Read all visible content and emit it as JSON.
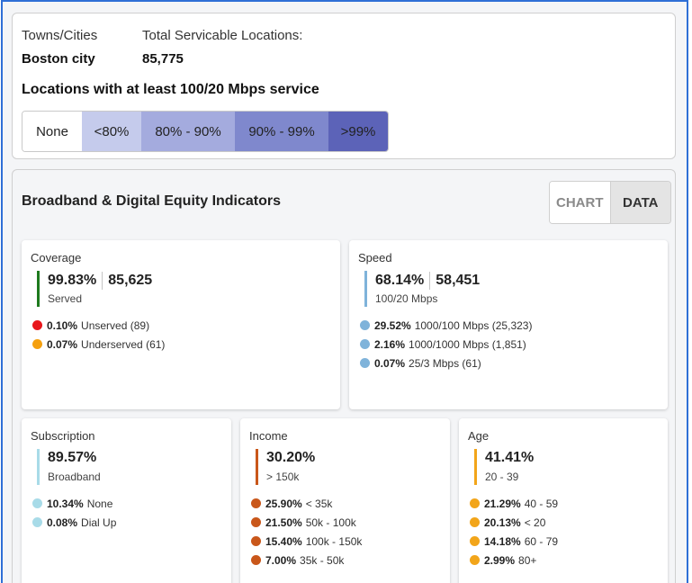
{
  "summary": {
    "towns_label": "Towns/Cities",
    "towns_value": "Boston city",
    "locations_label": "Total Servicable Locations:",
    "locations_value": "85,775",
    "legend_title": "Locations with at least 100/20 Mbps service",
    "legend": [
      {
        "label": "None",
        "color": "#ffffff"
      },
      {
        "label": "<80%",
        "color": "#c5cbec"
      },
      {
        "label": "80% - 90%",
        "color": "#a4abde"
      },
      {
        "label": "90% - 99%",
        "color": "#7f88cd"
      },
      {
        "label": ">99%",
        "color": "#5c63b8"
      }
    ]
  },
  "indicators": {
    "title": "Broadband & Digital Equity Indicators",
    "toggle": {
      "chart": "CHART",
      "data": "DATA",
      "active": "DATA"
    },
    "coverage": {
      "title": "Coverage",
      "pct": "99.83%",
      "count": "85,625",
      "sub": "Served",
      "bar_color": "#1e7a1e",
      "rows": [
        {
          "pct": "0.10%",
          "text": "Unserved (89)",
          "color": "#e8161b"
        },
        {
          "pct": "0.07%",
          "text": "Underserved (61)",
          "color": "#f5a00f"
        }
      ]
    },
    "speed": {
      "title": "Speed",
      "pct": "68.14%",
      "count": "58,451",
      "sub": "100/20 Mbps",
      "bar_color": "#7fb3da",
      "rows": [
        {
          "pct": "29.52%",
          "text": "1000/100 Mbps (25,323)",
          "color": "#7fb3da"
        },
        {
          "pct": "2.16%",
          "text": "1000/1000 Mbps (1,851)",
          "color": "#7fb3da"
        },
        {
          "pct": "0.07%",
          "text": "25/3 Mbps (61)",
          "color": "#7fb3da"
        }
      ]
    },
    "subscription": {
      "title": "Subscription",
      "pct": "89.57%",
      "sub": "Broadband",
      "bar_color": "#a8dbe8",
      "rows": [
        {
          "pct": "10.34%",
          "text": "None",
          "color": "#a8dbe8"
        },
        {
          "pct": "0.08%",
          "text": "Dial Up",
          "color": "#a8dbe8"
        }
      ]
    },
    "income": {
      "title": "Income",
      "pct": "30.20%",
      "sub": "> 150k",
      "bar_color": "#c9571a",
      "rows": [
        {
          "pct": "25.90%",
          "text": "< 35k",
          "color": "#c9571a"
        },
        {
          "pct": "21.50%",
          "text": "50k - 100k",
          "color": "#c9571a"
        },
        {
          "pct": "15.40%",
          "text": "100k - 150k",
          "color": "#c9571a"
        },
        {
          "pct": "7.00%",
          "text": "35k - 50k",
          "color": "#c9571a"
        }
      ]
    },
    "age": {
      "title": "Age",
      "pct": "41.41%",
      "sub": "20 - 39",
      "bar_color": "#f2a51a",
      "rows": [
        {
          "pct": "21.29%",
          "text": "40 - 59",
          "color": "#f2a51a"
        },
        {
          "pct": "20.13%",
          "text": "< 20",
          "color": "#f2a51a"
        },
        {
          "pct": "14.18%",
          "text": "60 - 79",
          "color": "#f2a51a"
        },
        {
          "pct": "2.99%",
          "text": "80+",
          "color": "#f2a51a"
        }
      ]
    }
  }
}
